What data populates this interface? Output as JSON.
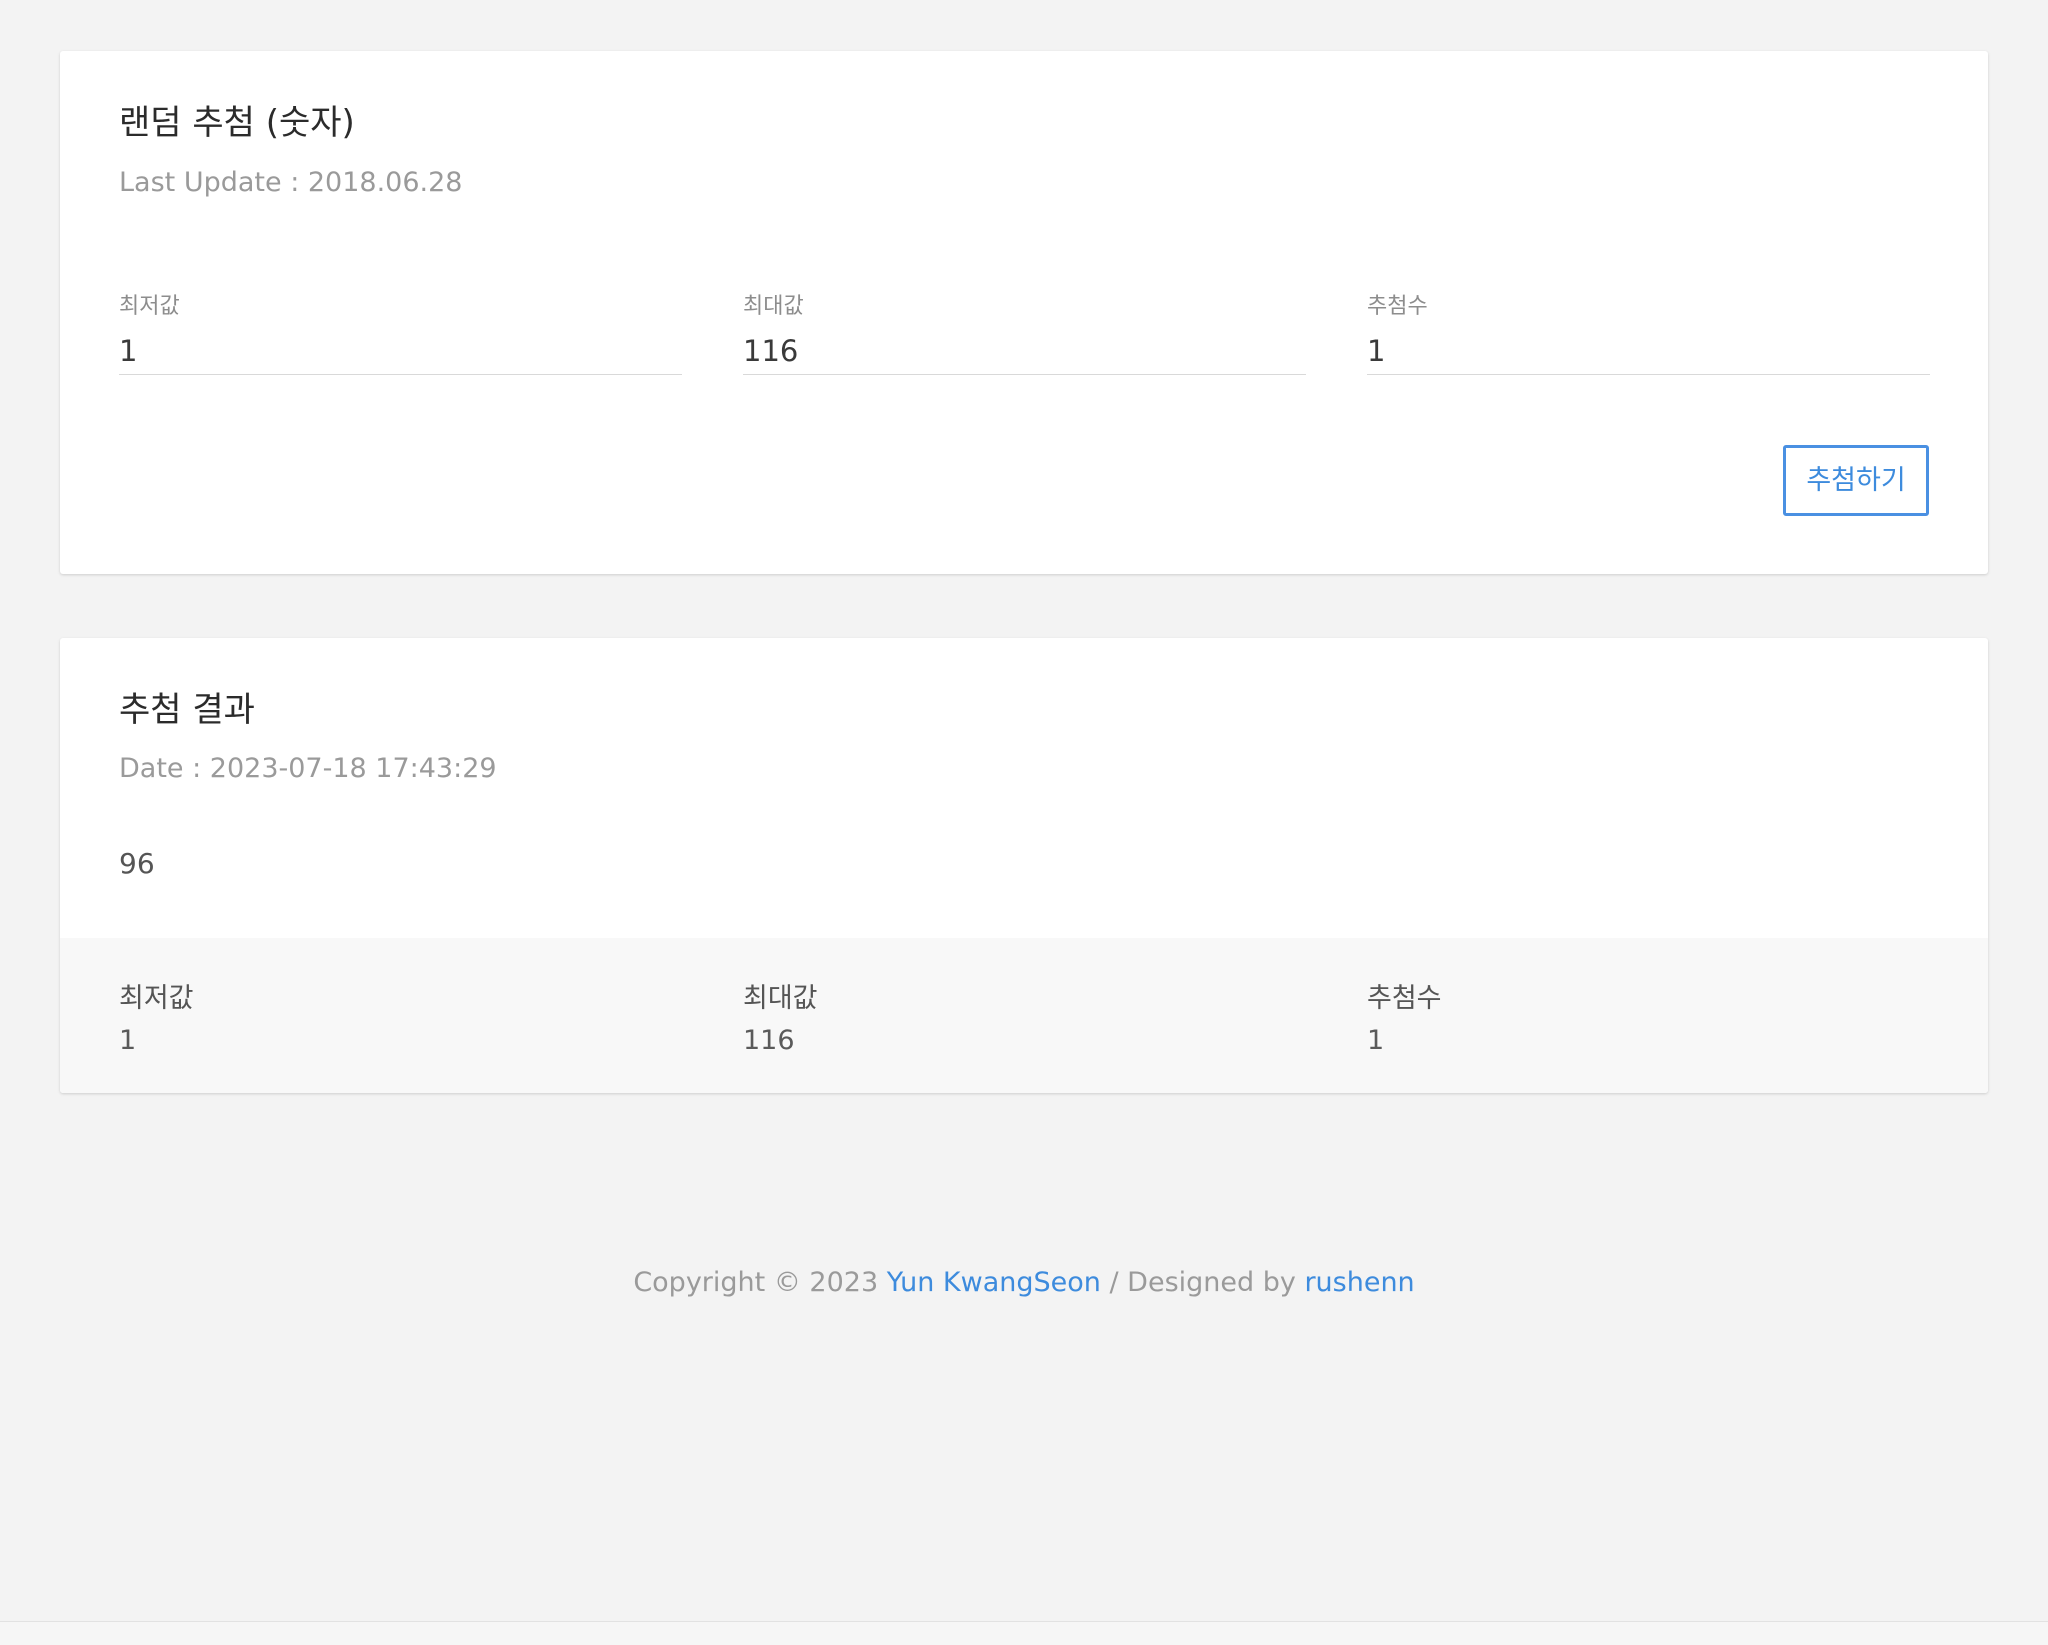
{
  "form_card": {
    "title": "랜덤 추첨 (숫자)",
    "last_update": "Last Update : 2018.06.28",
    "fields": {
      "min": {
        "label": "최저값",
        "value": "1"
      },
      "max": {
        "label": "최대값",
        "value": "116"
      },
      "count": {
        "label": "추첨수",
        "value": "1"
      }
    },
    "draw_button_label": "추첨하기"
  },
  "result_card": {
    "title": "추첨 결과",
    "date": "Date : 2023-07-18 17:43:29",
    "result_value": "96",
    "summary": {
      "min": {
        "label": "최저값",
        "value": "1"
      },
      "max": {
        "label": "최대값",
        "value": "116"
      },
      "count": {
        "label": "추첨수",
        "value": "1"
      }
    }
  },
  "footer": {
    "copyright_prefix": "Copyright © 2023",
    "author_link": "Yun KwangSeon",
    "designed_by": "/ Designed by",
    "designer_link": "rushenn"
  },
  "colors": {
    "accent": "#4a90e2",
    "background": "#f3f3f3",
    "card": "#ffffff"
  }
}
